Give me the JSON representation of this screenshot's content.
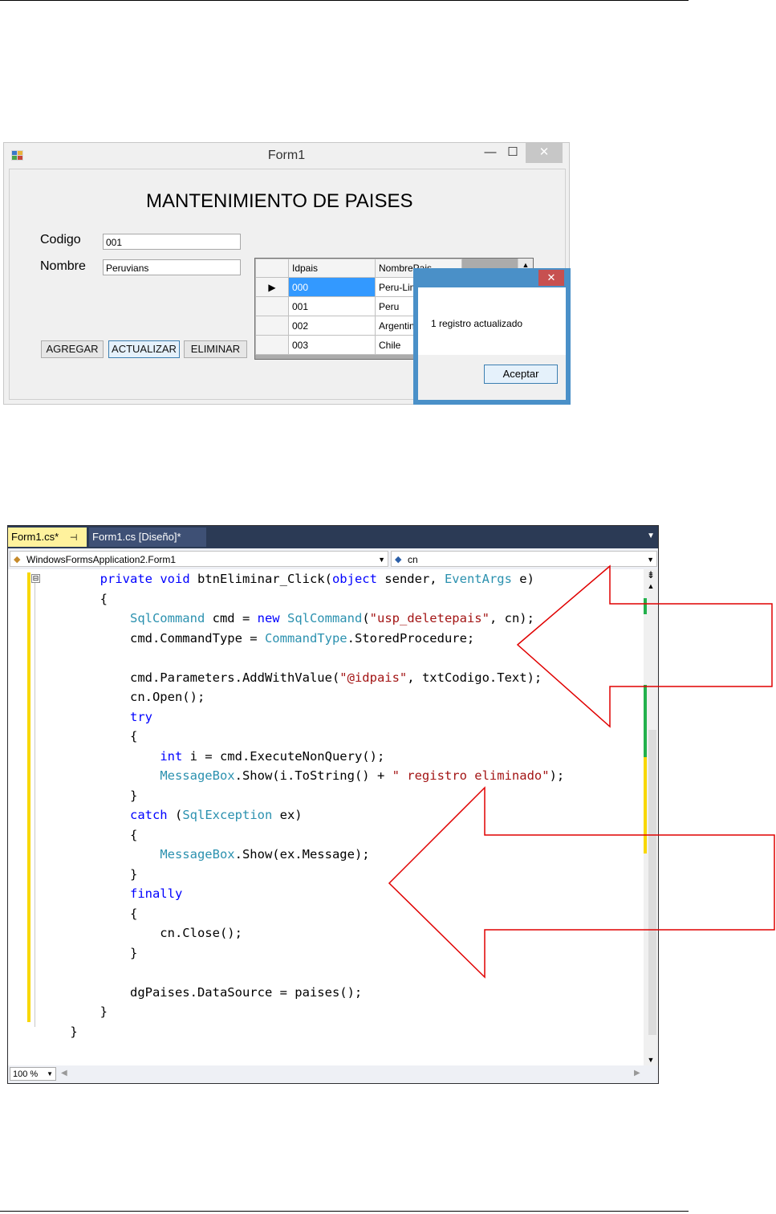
{
  "form_window": {
    "title": "Form1",
    "minimize": "—",
    "maximize": "☐",
    "close": "✕",
    "heading": "MANTENIMIENTO DE PAISES",
    "codigo_label": "Codigo",
    "codigo_value": "001",
    "nombre_label": "Nombre",
    "nombre_value": "Peruvians",
    "btn_agregar": "AGREGAR",
    "btn_actualizar": "ACTUALIZAR",
    "btn_eliminar": "ELIMINAR",
    "grid": {
      "columns": [
        "Idpais",
        "NombrePais"
      ],
      "rows": [
        {
          "id": "000",
          "name": "Peru-Lima",
          "selected": true
        },
        {
          "id": "001",
          "name": "Peru"
        },
        {
          "id": "002",
          "name": "Argentina"
        },
        {
          "id": "003",
          "name": "Chile"
        }
      ],
      "current_row_marker": "▶"
    }
  },
  "message_box": {
    "close": "✕",
    "message": "1 registro actualizado",
    "ok_button": "Aceptar"
  },
  "editor": {
    "tabs": [
      {
        "label": "Form1.cs*",
        "pin": "⊣",
        "close": "✕",
        "active": true
      },
      {
        "label": "Form1.cs [Diseño]*",
        "active": false
      }
    ],
    "tab_menu": "▼",
    "class_combo": "WindowsFormsApplication2.Form1",
    "member_combo": "cn",
    "zoom": "100 %",
    "collapse_glyph": "⊟",
    "code_lines": [
      [
        [
          "        ",
          ""
        ],
        [
          "private",
          "kw"
        ],
        [
          " ",
          ""
        ],
        [
          "void",
          "kw"
        ],
        [
          " btnEliminar_Click(",
          ""
        ],
        [
          "object",
          "kw"
        ],
        [
          " sender, ",
          ""
        ],
        [
          "EventArgs",
          "ty"
        ],
        [
          " e)",
          ""
        ]
      ],
      [
        [
          "        {",
          ""
        ]
      ],
      [
        [
          "            ",
          ""
        ],
        [
          "SqlCommand",
          "ty"
        ],
        [
          " cmd = ",
          ""
        ],
        [
          "new",
          "kw"
        ],
        [
          " ",
          ""
        ],
        [
          "SqlCommand",
          "ty"
        ],
        [
          "(",
          ""
        ],
        [
          "\"usp_deletepais\"",
          "st"
        ],
        [
          ", cn);",
          ""
        ]
      ],
      [
        [
          "            cmd.CommandType = ",
          ""
        ],
        [
          "CommandType",
          "ty"
        ],
        [
          ".StoredProcedure;",
          ""
        ]
      ],
      [
        [
          "",
          ""
        ]
      ],
      [
        [
          "            cmd.Parameters.AddWithValue(",
          ""
        ],
        [
          "\"@idpais\"",
          "st"
        ],
        [
          ", txtCodigo.Text);",
          ""
        ]
      ],
      [
        [
          "            cn.Open();",
          ""
        ]
      ],
      [
        [
          "            ",
          ""
        ],
        [
          "try",
          "kw"
        ]
      ],
      [
        [
          "            {",
          ""
        ]
      ],
      [
        [
          "                ",
          ""
        ],
        [
          "int",
          "kw"
        ],
        [
          " i = cmd.ExecuteNonQuery();",
          ""
        ]
      ],
      [
        [
          "                ",
          ""
        ],
        [
          "MessageBox",
          "ty"
        ],
        [
          ".Show(i.ToString() + ",
          ""
        ],
        [
          "\" registro eliminado\"",
          "st"
        ],
        [
          ");",
          ""
        ]
      ],
      [
        [
          "            }",
          ""
        ]
      ],
      [
        [
          "            ",
          ""
        ],
        [
          "catch",
          "kw"
        ],
        [
          " (",
          ""
        ],
        [
          "SqlException",
          "ty"
        ],
        [
          " ex)",
          ""
        ]
      ],
      [
        [
          "            {",
          ""
        ]
      ],
      [
        [
          "                ",
          ""
        ],
        [
          "MessageBox",
          "ty"
        ],
        [
          ".Show(ex.Message);",
          ""
        ]
      ],
      [
        [
          "            }",
          ""
        ]
      ],
      [
        [
          "            ",
          ""
        ],
        [
          "finally",
          "kw"
        ]
      ],
      [
        [
          "            {",
          ""
        ]
      ],
      [
        [
          "                cn.Close();",
          ""
        ]
      ],
      [
        [
          "            }",
          ""
        ]
      ],
      [
        [
          "",
          ""
        ]
      ],
      [
        [
          "            dgPaises.DataSource = paises();",
          ""
        ]
      ],
      [
        [
          "        }",
          ""
        ]
      ],
      [
        [
          "    }",
          ""
        ]
      ]
    ]
  },
  "colors": {
    "keyword": "#0000ff",
    "type": "#2b91af",
    "string": "#a31515",
    "arrow_stroke": "#e00000",
    "change_bar": "#f8d700"
  }
}
